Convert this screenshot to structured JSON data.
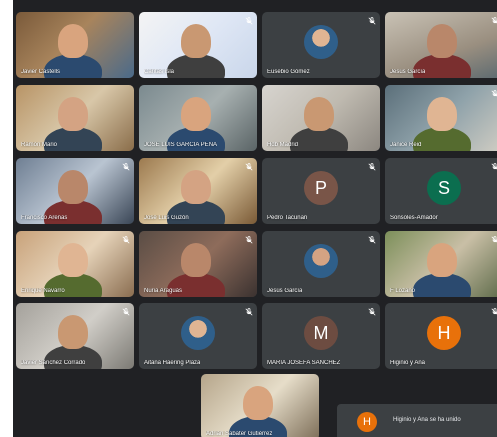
{
  "participants": [
    {
      "name": "Javier Castells",
      "muted": false
    },
    {
      "name": "Caritas Isla",
      "muted": true
    },
    {
      "name": "Eusebio Gómez",
      "muted": true
    },
    {
      "name": "Jesús García",
      "muted": true
    },
    {
      "name": "Ramón Mario",
      "muted": false
    },
    {
      "name": "JOSE LUIS GARCÍA PEÑA",
      "muted": false
    },
    {
      "name": "Hdb Madrid",
      "muted": false
    },
    {
      "name": "Janice Reid",
      "muted": true
    },
    {
      "name": "Francisco Arenas",
      "muted": true
    },
    {
      "name": "José Luis Guzón",
      "muted": true
    },
    {
      "name": "Pedro Tacunan",
      "muted": true,
      "initial": "P",
      "avatar_color": "#795548"
    },
    {
      "name": "Sonsoles-Amador",
      "muted": true,
      "initial": "S",
      "avatar_color": "#0b6e4f"
    },
    {
      "name": "Enrique Navarro",
      "muted": true
    },
    {
      "name": "Nuria Araguás",
      "muted": true
    },
    {
      "name": "Jesús García",
      "muted": true
    },
    {
      "name": "F Lozano",
      "muted": true
    },
    {
      "name": "Javier Sánchez Corrado",
      "muted": true
    },
    {
      "name": "Aitana Haering Plaza",
      "muted": true
    },
    {
      "name": "MARIA JOSEFA SANCHEZ",
      "muted": true,
      "initial": "M",
      "avatar_color": "#6d4c41"
    },
    {
      "name": "Higinio y Ana",
      "muted": true,
      "initial": "H",
      "avatar_color": "#e8710a"
    },
    {
      "name": "Adrián Sabater Gutiérrez",
      "muted": false
    }
  ],
  "notification": {
    "initial": "H",
    "text": "Higinio y Ana se ha unido"
  },
  "colors": {
    "background": "#202124",
    "tile": "#3c4043",
    "accent_orange": "#e8710a"
  }
}
